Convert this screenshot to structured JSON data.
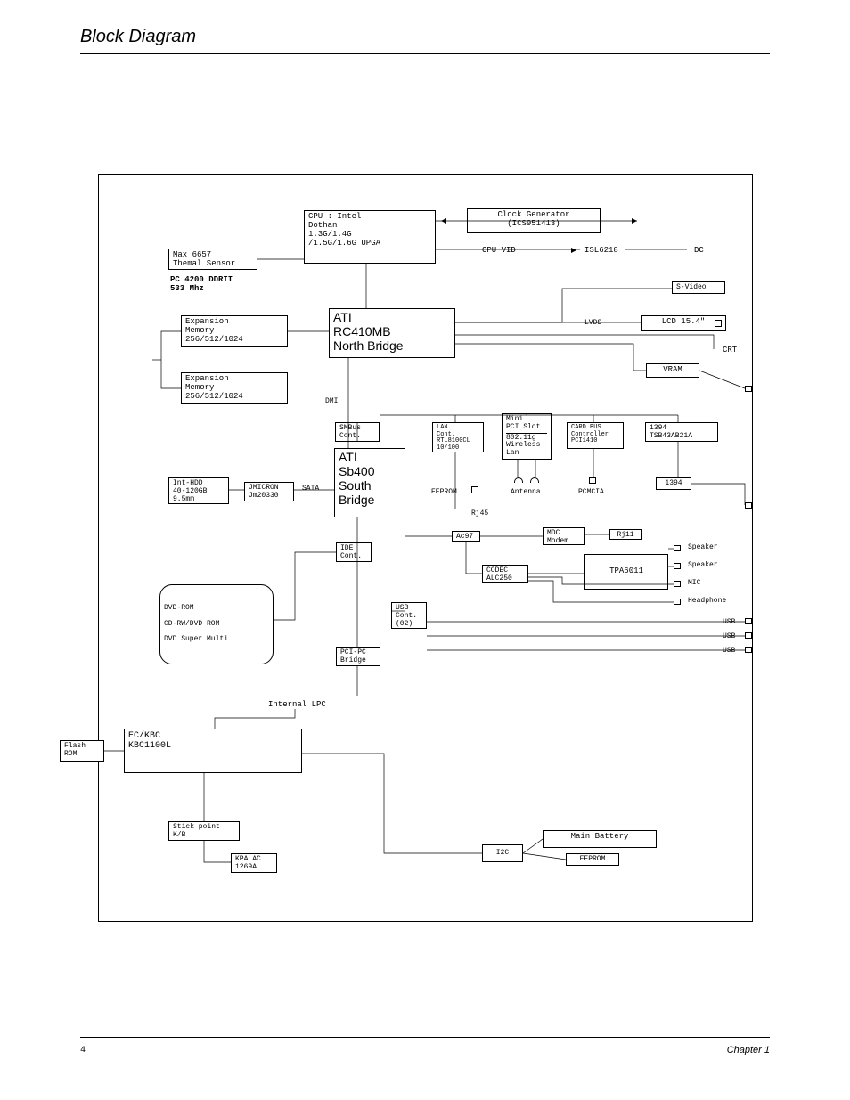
{
  "page": {
    "title": "Block Diagram",
    "footer_page": "4",
    "footer_chapter": "Chapter 1"
  },
  "cpu": {
    "line1": "CPU : Intel",
    "line2": "Dothan",
    "line3": "1.3G/1.4G",
    "line4": "/1.5G/1.6G UPGA"
  },
  "clockgen": {
    "line1": "Clock Generator",
    "line2": "(ICS951413)"
  },
  "cpuvid": "CPU VID",
  "isl": "ISL6218",
  "dc": "DC",
  "thermal": {
    "line1": "Max 6657",
    "line2": "Themal Sensor"
  },
  "ddr": {
    "line1": "PC 4200 DDRII",
    "line2": "533 Mhz"
  },
  "exp1": {
    "line1": "Expansion",
    "line2": "Memory",
    "line3": "256/512/1024"
  },
  "exp2": {
    "line1": "Expansion",
    "line2": "Memory",
    "line3": "256/512/1024"
  },
  "northbridge": {
    "line1": "ATI",
    "line2": "RC410MB",
    "line3": "North Bridge"
  },
  "svideo": "S-Video",
  "lvds": "LVDS",
  "lcd": "LCD 15.4\"",
  "crt": "CRT",
  "vram": "VRAM",
  "dmi": "DMI",
  "smbus": {
    "line1": "SMBus",
    "line2": "Cont."
  },
  "lan": {
    "line1": "LAN",
    "line2": "Cont.",
    "line3": "RTL8100CL",
    "line4": "10/100"
  },
  "minipci": {
    "line1": "Mini",
    "line2": "PCI Slot",
    "line3": "802.11g",
    "line4": "Wireless",
    "line5": "Lan"
  },
  "cardbus": {
    "line1": "CARD BUS",
    "line2": "Controller",
    "line3": "PCI1410"
  },
  "ieee1394chip": {
    "line1": "1394",
    "line2": "TSB43AB21A"
  },
  "antenna": "Antenna",
  "pcmcia": "PCMCIA",
  "ieee1394": "1394",
  "rj45": "Rj45",
  "southbridge": {
    "line1": "ATI",
    "line2": "Sb400",
    "line3": "South",
    "line4": "Bridge"
  },
  "sata": "SATA",
  "jmicron": {
    "line1": "JMICRON",
    "line2": "Jm20330"
  },
  "hdd": {
    "line1": "Int-HDD",
    "line2": "40-120GB",
    "line3": "9.5mm"
  },
  "ac97": "Ac97",
  "ide": {
    "line1": "IDE",
    "line2": "Cont."
  },
  "mdc": {
    "line1": "MDC",
    "line2": "Modem"
  },
  "rj11": "Rj11",
  "codec": {
    "line1": "CODEC",
    "line2": "ALC250"
  },
  "tpa": "TPA6011",
  "speaker": "Speaker",
  "mic": "MIC",
  "headphone": "Headphone",
  "usb_cont": {
    "line1": "USB",
    "line2": "Cont.",
    "line3": "(02)"
  },
  "usb": "USB",
  "pcipc": {
    "line1": "PCI-PC",
    "line2": "Bridge"
  },
  "optical": {
    "line1": "DVD-ROM",
    "line2": "CD-RW/DVD ROM",
    "line3": "DVD Super Multi"
  },
  "internal_lpc": "Internal LPC",
  "eckbc": {
    "line1": "EC/KBC",
    "line2": "KBC1100L"
  },
  "flashrom": {
    "line1": "Flash",
    "line2": "ROM"
  },
  "stick": {
    "line1": "Stick point",
    "line2": "K/B"
  },
  "kpaac": {
    "line1": "KPA AC",
    "line2": "1269A"
  },
  "i2c": "I2C",
  "mainbatt": "Main Battery",
  "eeprom_label": "EEPROM",
  "eeprom_batt": "EEPROM"
}
